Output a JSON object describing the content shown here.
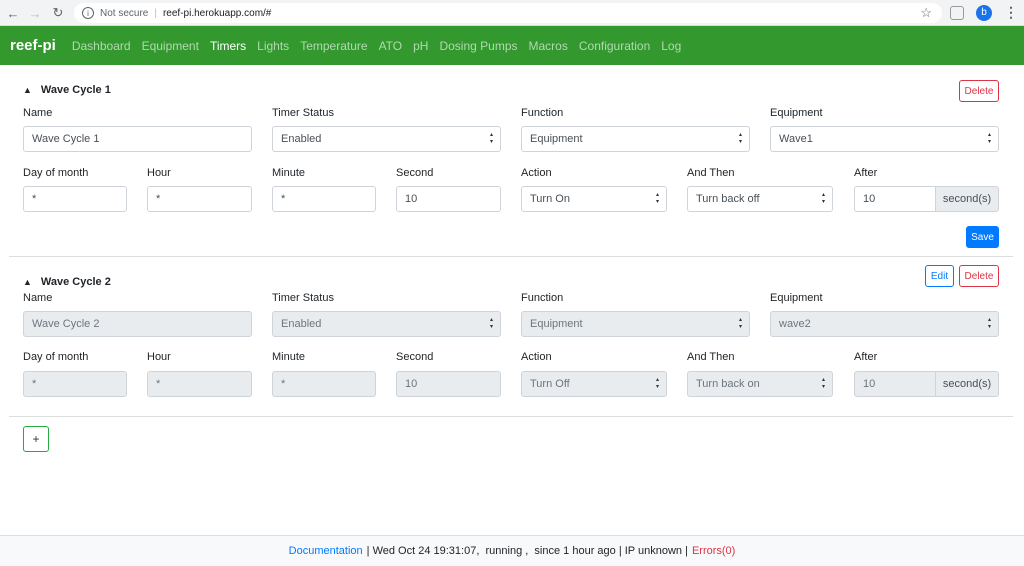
{
  "browser": {
    "security": "Not secure",
    "url": "reef-pi.herokuapp.com/#",
    "profile_initial": "b"
  },
  "navbar": {
    "brand": "reef-pi",
    "links": [
      "Dashboard",
      "Equipment",
      "Timers",
      "Lights",
      "Temperature",
      "ATO",
      "pH",
      "Dosing Pumps",
      "Macros",
      "Configuration",
      "Log"
    ],
    "active": "Timers"
  },
  "labels": {
    "name": "Name",
    "timer_status": "Timer Status",
    "function": "Function",
    "equipment": "Equipment",
    "day_of_month": "Day of month",
    "hour": "Hour",
    "minute": "Minute",
    "second": "Second",
    "action": "Action",
    "and_then": "And Then",
    "after": "After",
    "seconds_unit": "second(s)",
    "delete": "Delete",
    "edit": "Edit",
    "save": "Save",
    "add": "+"
  },
  "timers": [
    {
      "title": "Wave Cycle 1",
      "name": "Wave Cycle 1",
      "status": "Enabled",
      "function": "Equipment",
      "equipment": "Wave1",
      "day": "*",
      "hour": "*",
      "minute": "*",
      "second": "10",
      "action": "Turn On",
      "then": "Turn back off",
      "after": "10"
    },
    {
      "title": "Wave Cycle 2",
      "name": "Wave Cycle 2",
      "status": "Enabled",
      "function": "Equipment",
      "equipment": "wave2",
      "day": "*",
      "hour": "*",
      "minute": "*",
      "second": "10",
      "action": "Turn Off",
      "then": "Turn back on",
      "after": "10"
    }
  ],
  "footer": {
    "documentation": "Documentation",
    "status": "| Wed Oct 24 19:31:07,  running ,  since 1 hour ago | IP unknown |",
    "errors": "Errors(0)"
  }
}
